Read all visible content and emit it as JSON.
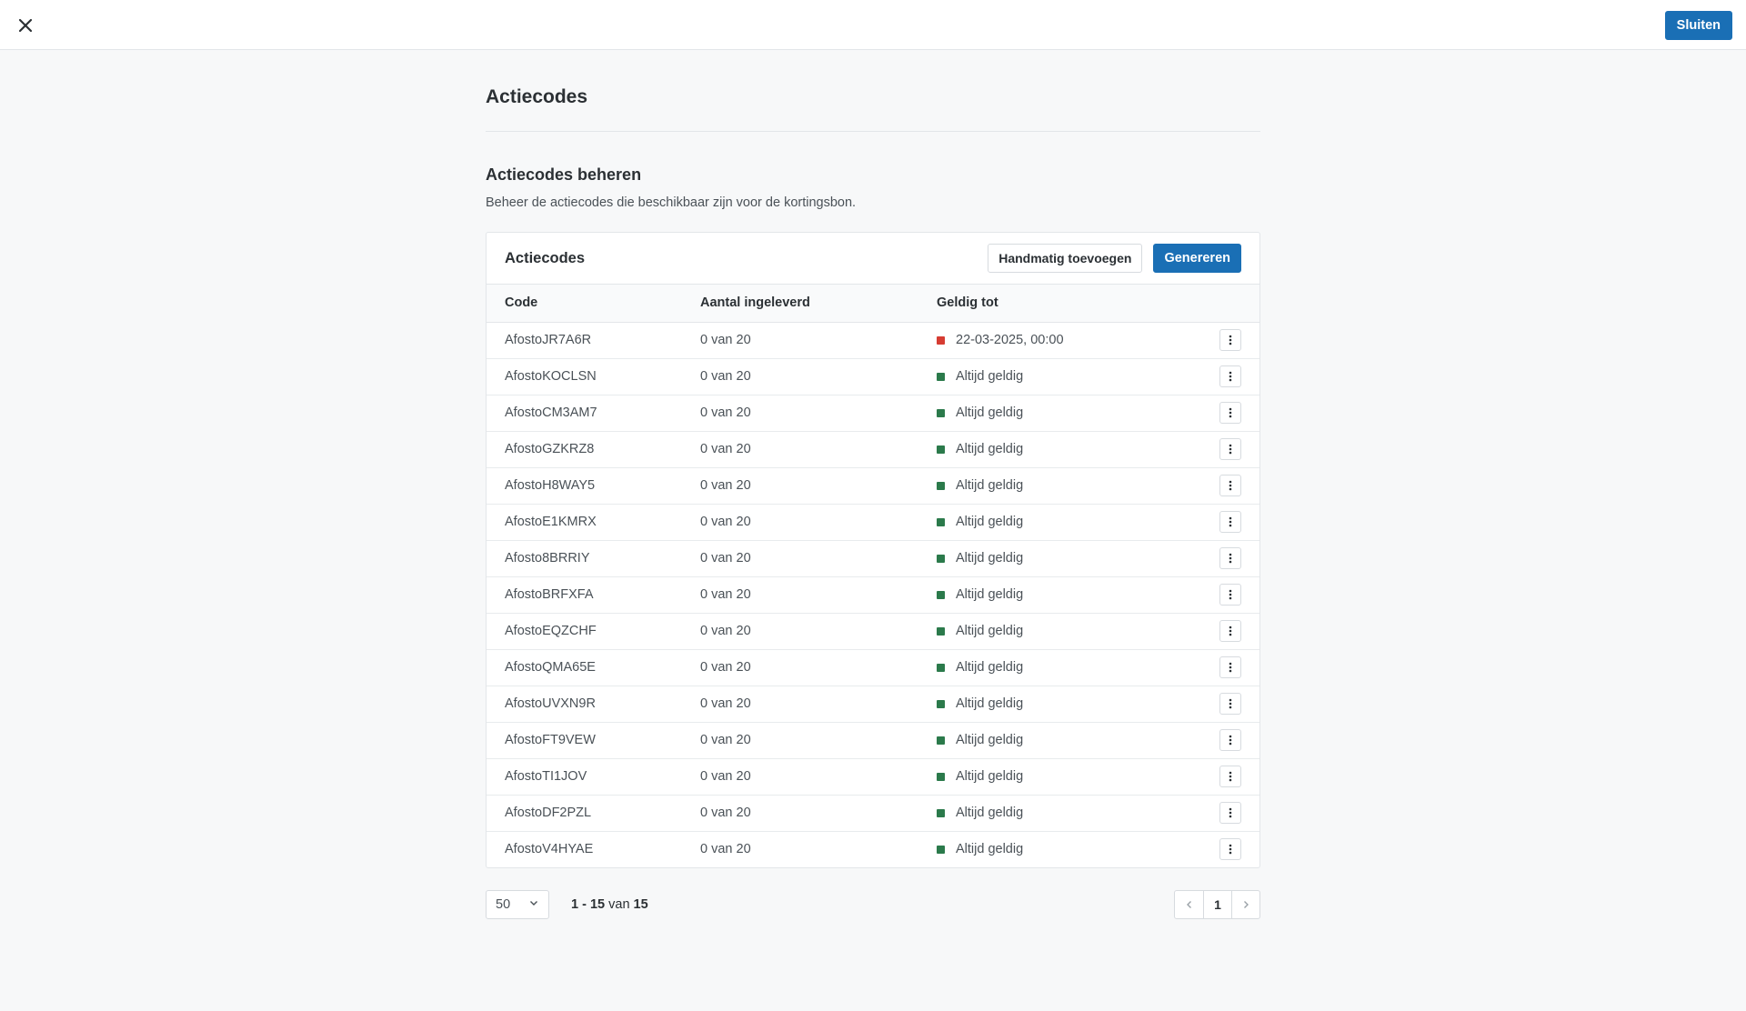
{
  "topbar": {
    "close_button": "Sluiten"
  },
  "page": {
    "title": "Actiecodes",
    "section_title": "Actiecodes beheren",
    "section_description": "Beheer de actiecodes die beschikbaar zijn voor de kortingsbon."
  },
  "card": {
    "title": "Actiecodes",
    "manual_add_label": "Handmatig toevoegen",
    "generate_label": "Genereren"
  },
  "table": {
    "headers": {
      "code": "Code",
      "count": "Aantal ingeleverd",
      "valid": "Geldig tot"
    },
    "rows": [
      {
        "code": "AfostoJR7A6R",
        "count": "0 van 20",
        "valid": "22-03-2025, 00:00",
        "status": "expired"
      },
      {
        "code": "AfostoKOCLSN",
        "count": "0 van 20",
        "valid": "Altijd geldig",
        "status": "valid"
      },
      {
        "code": "AfostoCM3AM7",
        "count": "0 van 20",
        "valid": "Altijd geldig",
        "status": "valid"
      },
      {
        "code": "AfostoGZKRZ8",
        "count": "0 van 20",
        "valid": "Altijd geldig",
        "status": "valid"
      },
      {
        "code": "AfostoH8WAY5",
        "count": "0 van 20",
        "valid": "Altijd geldig",
        "status": "valid"
      },
      {
        "code": "AfostoE1KMRX",
        "count": "0 van 20",
        "valid": "Altijd geldig",
        "status": "valid"
      },
      {
        "code": "Afosto8BRRIY",
        "count": "0 van 20",
        "valid": "Altijd geldig",
        "status": "valid"
      },
      {
        "code": "AfostoBRFXFA",
        "count": "0 van 20",
        "valid": "Altijd geldig",
        "status": "valid"
      },
      {
        "code": "AfostoEQZCHF",
        "count": "0 van 20",
        "valid": "Altijd geldig",
        "status": "valid"
      },
      {
        "code": "AfostoQMA65E",
        "count": "0 van 20",
        "valid": "Altijd geldig",
        "status": "valid"
      },
      {
        "code": "AfostoUVXN9R",
        "count": "0 van 20",
        "valid": "Altijd geldig",
        "status": "valid"
      },
      {
        "code": "AfostoFT9VEW",
        "count": "0 van 20",
        "valid": "Altijd geldig",
        "status": "valid"
      },
      {
        "code": "AfostoTI1JOV",
        "count": "0 van 20",
        "valid": "Altijd geldig",
        "status": "valid"
      },
      {
        "code": "AfostoDF2PZL",
        "count": "0 van 20",
        "valid": "Altijd geldig",
        "status": "valid"
      },
      {
        "code": "AfostoV4HYAE",
        "count": "0 van 20",
        "valid": "Altijd geldig",
        "status": "valid"
      }
    ]
  },
  "status_colors": {
    "expired": "#d63c32",
    "valid": "#2b7a4b"
  },
  "pagination": {
    "per_page": "50",
    "range_start": "1",
    "range_sep": " - ",
    "range_end": "15",
    "range_of": " van ",
    "total": "15",
    "current_page": "1"
  },
  "icons": {
    "close": "close-icon",
    "kebab": "vertical-dots-icon",
    "chevron_down": "chevron-down-icon",
    "prev": "chevron-left-icon",
    "next": "chevron-right-icon"
  }
}
